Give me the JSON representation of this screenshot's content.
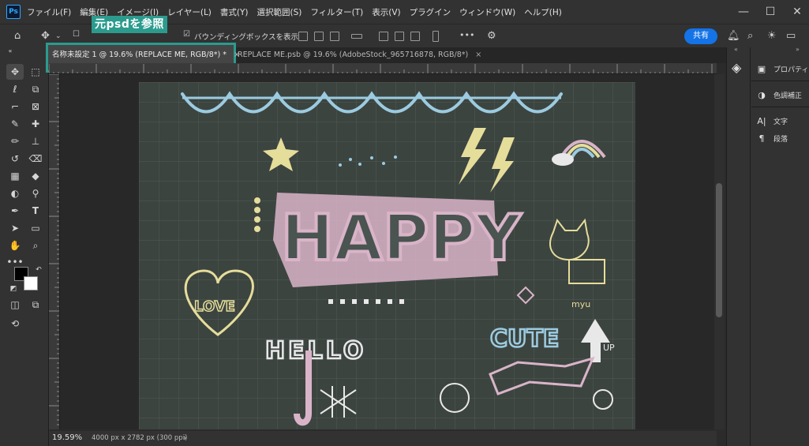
{
  "app": {
    "logo": "Ps"
  },
  "menu": [
    "ファイル(F)",
    "編集(E)",
    "イメージ(I)",
    "レイヤー(L)",
    "書式(Y)",
    "選択範囲(S)",
    "フィルター(T)",
    "表示(V)",
    "プラグイン",
    "ウィンドウ(W)",
    "ヘルプ(H)"
  ],
  "window_controls": {
    "minimize": "—",
    "maximize": "☐",
    "close": "✕"
  },
  "options_bar": {
    "bounding_box_label": "バウンディングボックスを表示",
    "share_label": "共有",
    "more_label": "•••"
  },
  "callout": {
    "text": "元psdを参照",
    "color": "#2b9b8e"
  },
  "tabs": [
    {
      "label": "名称未設定 1 @ 19.6% (REPLACE ME, RGB/8*) *",
      "close": "×",
      "active": true
    },
    {
      "label": "REPLACE ME.psb @ 19.6% (AdobeStock_965716878, RGB/8*)",
      "close": "×",
      "active": false
    }
  ],
  "artwork": {
    "words": [
      "HAPPY",
      "LOVE",
      "HELLO",
      "CUTE",
      "UP",
      "myu"
    ],
    "colors": {
      "board": "#3c4440",
      "pink": "#d9b4c8",
      "blue": "#9ccbe0",
      "yellow": "#e5dd9a",
      "white": "#e8e8e8"
    }
  },
  "status": {
    "zoom": "19.59%",
    "doc_info": "4000 px x 2782 px (300 ppi)",
    "arrow": "›"
  },
  "right_panels": [
    {
      "icon": "properties-icon",
      "label": "プロパティ"
    },
    {
      "icon": "adjustments-icon",
      "label": "色調補正"
    },
    {
      "icon": "character-icon",
      "label": "文字"
    },
    {
      "icon": "paragraph-icon",
      "label": "段落"
    }
  ],
  "colors": {
    "accent": "#1473e6",
    "highlight": "#2b9b8e",
    "foreground": "#000000",
    "background": "#ffffff"
  }
}
